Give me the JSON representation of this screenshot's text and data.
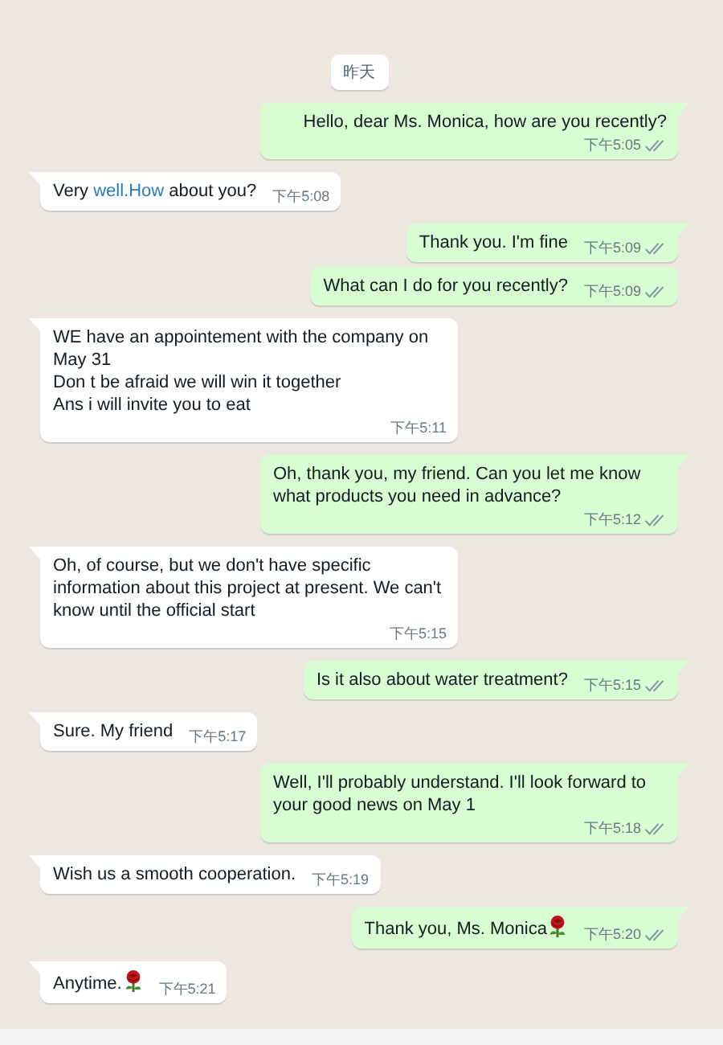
{
  "date_divider": "昨天",
  "messages": [
    {
      "kind": "outgoing",
      "tail": true,
      "text": "Hello, dear Ms. Monica, how are you recently?",
      "time": "下午5:05",
      "read": false
    },
    {
      "kind": "incoming",
      "tail": true,
      "parts": [
        {
          "kind": "plain",
          "text": "Very "
        },
        {
          "kind": "link",
          "text": "well.How"
        },
        {
          "kind": "plain",
          "text": " about you?"
        }
      ],
      "time": "下午5:08"
    },
    {
      "kind": "outgoing",
      "tail": true,
      "text": "Thank you. I'm fine",
      "time": "下午5:09",
      "read": false
    },
    {
      "kind": "outgoing",
      "tail": false,
      "text": "What can I do for you recently?",
      "time": "下午5:09",
      "read": false
    },
    {
      "kind": "incoming",
      "tail": true,
      "text": "WE have an appointement with the company on May 31\nDon t be afraid we will win it together\nAns i will invite you to eat",
      "time": "下午5:11"
    },
    {
      "kind": "outgoing",
      "tail": true,
      "text": "Oh, thank you, my friend. Can you let me know what products you need in advance?",
      "time": "下午5:12",
      "read": false
    },
    {
      "kind": "incoming",
      "tail": true,
      "text": "Oh, of course, but we don't have specific information about this project at present. We can't know until the official start",
      "time": "下午5:15"
    },
    {
      "kind": "outgoing",
      "tail": true,
      "text": "Is it also about water treatment?",
      "time": "下午5:15",
      "read": false
    },
    {
      "kind": "incoming",
      "tail": true,
      "text": "Sure. My friend",
      "time": "下午5:17"
    },
    {
      "kind": "outgoing",
      "tail": true,
      "text": "Well, I'll probably understand. I'll look forward to your good news on May 1",
      "time": "下午5:18",
      "read": false
    },
    {
      "kind": "incoming",
      "tail": true,
      "text": "Wish us a smooth cooperation.",
      "time": "下午5:19"
    },
    {
      "kind": "outgoing",
      "tail": true,
      "text": "Thank you, Ms. Monica",
      "trailing_emoji": true,
      "time": "下午5:20",
      "read": false
    },
    {
      "kind": "incoming",
      "tail": true,
      "text": "Anytime.",
      "trailing_emoji": true,
      "time": "下午5:21"
    }
  ]
}
